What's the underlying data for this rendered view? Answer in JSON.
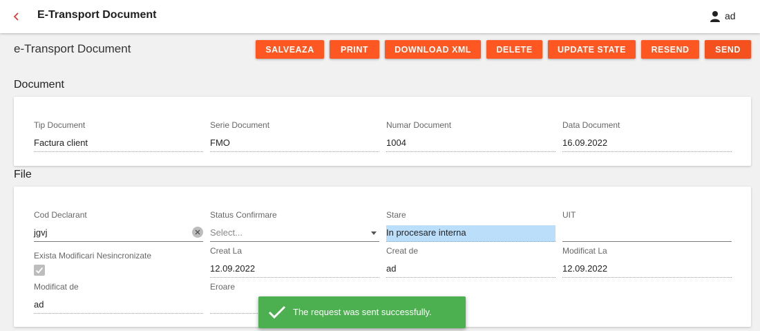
{
  "header": {
    "title": "E-Transport Document",
    "user": "ad"
  },
  "page_title": "e-Transport Document",
  "toolbar": {
    "buttons": [
      {
        "label": "SALVEAZA"
      },
      {
        "label": "PRINT"
      },
      {
        "label": "DOWNLOAD XML"
      },
      {
        "label": "DELETE"
      },
      {
        "label": "UPDATE STATE"
      },
      {
        "label": "RESEND"
      },
      {
        "label": "SEND"
      }
    ]
  },
  "document_section": {
    "title": "Document",
    "fields": {
      "tip_document": {
        "label": "Tip Document",
        "value": "Factura client"
      },
      "serie_document": {
        "label": "Serie Document",
        "value": "FMO"
      },
      "numar_document": {
        "label": "Numar Document",
        "value": "1004"
      },
      "data_document": {
        "label": "Data Document",
        "value": "16.09.2022"
      }
    }
  },
  "file_section": {
    "title": "File",
    "fields": {
      "cod_declarant": {
        "label": "Cod Declarant",
        "value": "jgvj"
      },
      "status_confirmare": {
        "label": "Status Confirmare",
        "placeholder": "Select..."
      },
      "stare": {
        "label": "Stare",
        "value": "In procesare interna"
      },
      "uit": {
        "label": "UIT",
        "value": ""
      },
      "exista_modificari": {
        "label": "Exista Modificari Nesincronizate",
        "checked": true
      },
      "creat_la": {
        "label": "Creat La",
        "value": "12.09.2022"
      },
      "creat_de": {
        "label": "Creat de",
        "value": "ad"
      },
      "modificat_la": {
        "label": "Modificat La",
        "value": "12.09.2022"
      },
      "modificat_de": {
        "label": "Modificat de",
        "value": "ad"
      },
      "eroare": {
        "label": "Eroare",
        "value": ""
      }
    }
  },
  "toast": {
    "message": "The request was sent successfully."
  },
  "colors": {
    "accent": "#ff5722",
    "toast": "#4caf50",
    "highlight": "#bbdefb",
    "back": "#e53935"
  }
}
